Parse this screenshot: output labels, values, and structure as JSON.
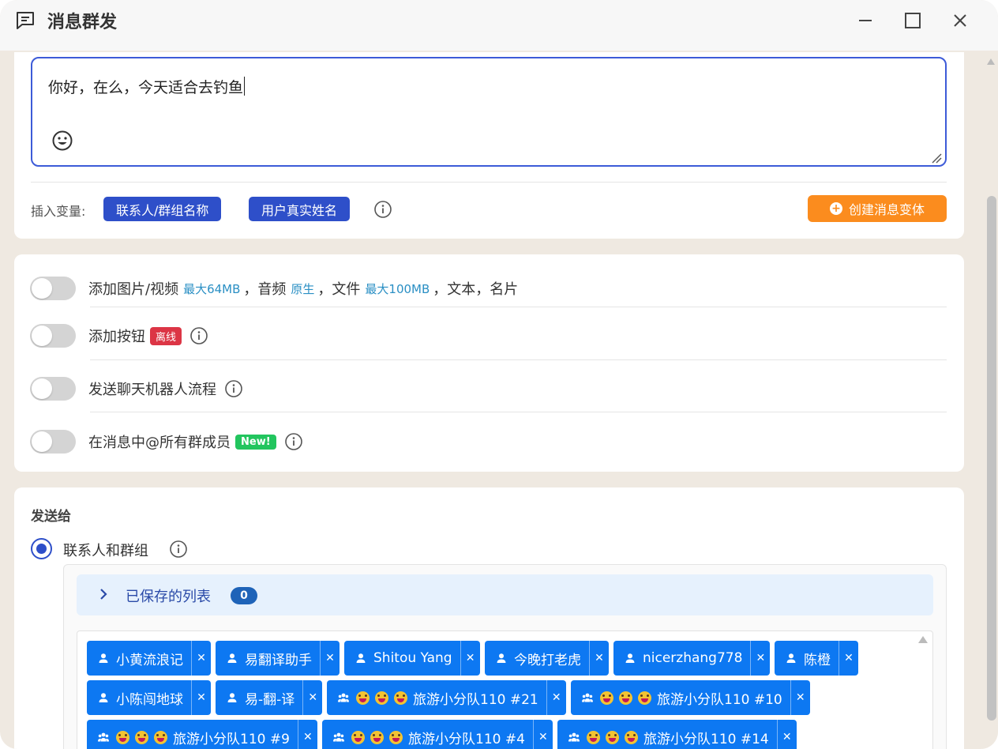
{
  "window": {
    "title": "消息群发",
    "title_icon": "message-square-icon",
    "controls": [
      "minimize-icon",
      "maximize-icon",
      "close-icon"
    ]
  },
  "composer": {
    "message_text": "你好，在么，今天适合去钓鱼",
    "emoji_icon": "smiley-icon",
    "insert_variable_label": "插入变量:",
    "variables": [
      "联系人/群组名称",
      "用户真实姓名"
    ],
    "create_variant_label": "创建消息变体"
  },
  "options": {
    "media": {
      "label_a": "添加图片/视频",
      "hint_a": "最大64MB",
      "label_b": "，音频",
      "hint_b": "原生",
      "label_c": "，文件",
      "hint_c": "最大100MB",
      "label_d": "，文本，名片",
      "enabled": false
    },
    "buttons": {
      "label": "添加按钮",
      "badge": "离线",
      "enabled": false
    },
    "chatbot": {
      "label": "发送聊天机器人流程",
      "enabled": false
    },
    "mention_all": {
      "label": "在消息中@所有群成员",
      "badge": "New!",
      "enabled": false
    }
  },
  "send_to": {
    "title": "发送给",
    "radio_label": "联系人和群组",
    "radio_selected": true,
    "saved_lists_label": "已保存的列表",
    "saved_lists_count": "0",
    "recipients": [
      {
        "type": "contact",
        "name": "小黄流浪记"
      },
      {
        "type": "contact",
        "name": "易翻译助手"
      },
      {
        "type": "contact",
        "name": "Shitou Yang"
      },
      {
        "type": "contact",
        "name": "今晚打老虎"
      },
      {
        "type": "contact",
        "name": "nicerzhang778"
      },
      {
        "type": "contact",
        "name": "陈橙"
      },
      {
        "type": "contact",
        "name": "小陈闯地球"
      },
      {
        "type": "contact",
        "name": "易-翻-译"
      },
      {
        "type": "group",
        "name": "旅游小分队110 #21"
      },
      {
        "type": "group",
        "name": "旅游小分队110 #10"
      },
      {
        "type": "group",
        "name": "旅游小分队110 #9"
      },
      {
        "type": "group",
        "name": "旅游小分队110 #4"
      },
      {
        "type": "group",
        "name": "旅游小分队110 #14"
      }
    ]
  },
  "colors": {
    "primary": "#2e4fc9",
    "tag_blue": "#0d78f2",
    "orange": "#fb8c1e",
    "badge_red": "#dc3545",
    "badge_green": "#22c55e",
    "background": "#efe9e1"
  }
}
